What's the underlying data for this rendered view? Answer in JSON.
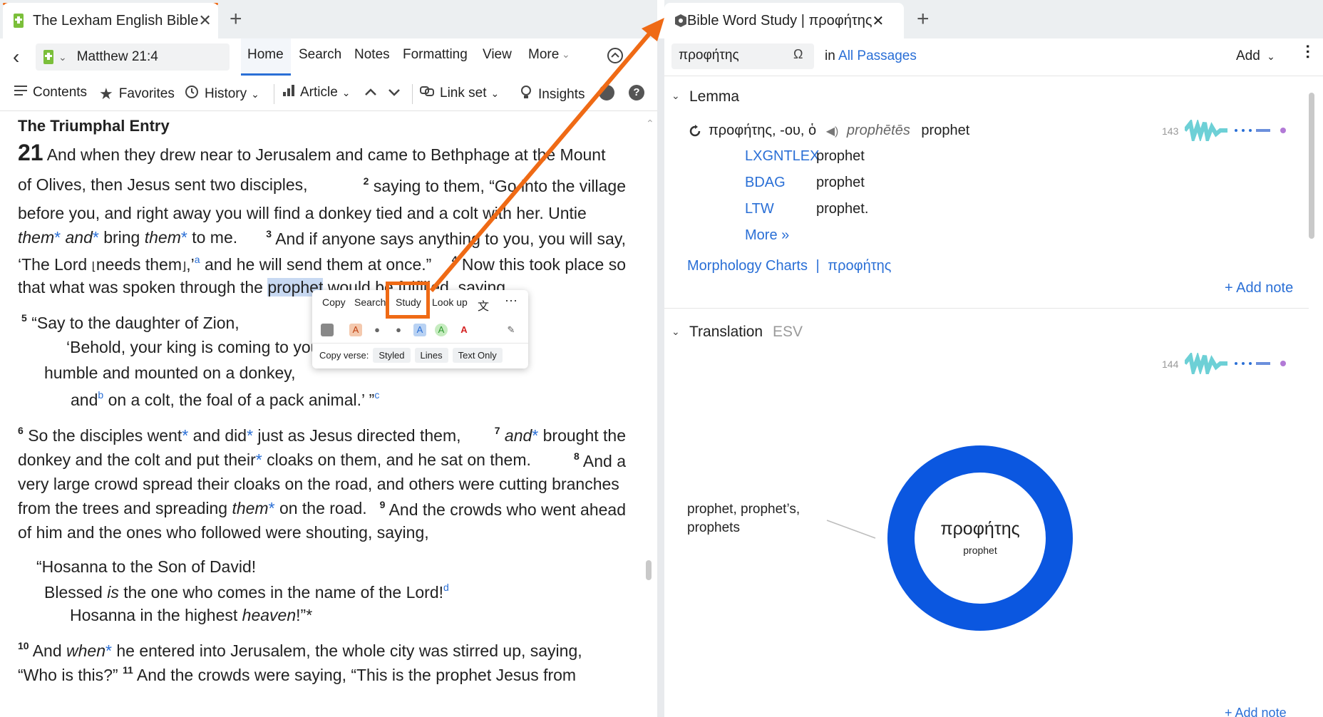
{
  "left": {
    "tab_title": "The Lexham English Bible",
    "reference": "Matthew 21:4",
    "nav": [
      "Home",
      "Search",
      "Notes",
      "Formatting",
      "View",
      "More"
    ],
    "toolbar": {
      "contents": "Contents",
      "favorites": "Favorites",
      "history": "History",
      "article": "Article",
      "link_set": "Link set",
      "insights": "Insights"
    },
    "passage": {
      "heading": "The Triumphal Entry",
      "chapter": "21",
      "l1": "And when they drew near to Jerusalem and came to Bethphage at the Mount",
      "l2a": "of Olives, then Jesus sent two disciples,",
      "v2": "2",
      "l2b": "saying to them, “Go into the village",
      "l3": "before you, and right away you will find a donkey tied and a colt with her. Untie",
      "l4a": "them",
      "l4b": "and",
      "l4c": "bring",
      "l4d": "them",
      "l4e": "to me.",
      "v3": "3",
      "l4f": "And if anyone says anything to you, you will say,",
      "l5a": "‘The Lord",
      "l5b": "needs them",
      "l5c": ",’",
      "fn_a": "a",
      "l5d": "and he will send them at once.”",
      "v4": "4",
      "l5e": "Now this took place so",
      "l6a": "that what was spoken through the",
      "l6hl": "prophet",
      "l6b": "would be fulfilled, saying,",
      "v5": "5",
      "q1": "“Say to the daughter of Zion,",
      "q2": "‘Behold, your king is coming to you,",
      "q3": "humble and mounted on a donkey,",
      "q4a": "and",
      "fn_b": "b",
      "q4b": "on a colt, the foal of a pack animal.’ ”",
      "fn_c": "c",
      "v6": "6",
      "p1a": "So the disciples went",
      "p1b": "and did",
      "p1c": "just as Jesus directed them,",
      "v7": "7",
      "p1d": "and",
      "p1e": "brought the",
      "p2a": "donkey and the colt and put their",
      "p2b": "cloaks on them, and he sat on them.",
      "v8": "8",
      "p2c": "And a",
      "p3": "very large crowd spread their cloaks on the road, and others were cutting branches",
      "p4a": "from the trees and spreading",
      "p4b": "them",
      "p4c": "on the road.",
      "v9": "9",
      "p4d": "And the crowds who went ahead",
      "p5": "of him and the ones who followed were shouting, saying,",
      "h1": "“Hosanna to the Son of David!",
      "h2a": "Blessed",
      "h2b": "is",
      "h2c": "the one who comes in the name of the Lord!",
      "fn_d": "d",
      "h3a": "Hosanna in the highest",
      "h3b": "heaven",
      "h3c": "!”",
      "v10": "10",
      "e1a": "And",
      "e1b": "when",
      "e1c": "he entered into Jerusalem, the whole city was stirred up, saying,",
      "e2a": "“Who is this?”",
      "v11": "11",
      "e2b": "And the crowds were saying, “This is the prophet Jesus from",
      "star": "*"
    },
    "popup": {
      "items": [
        "Copy",
        "Search",
        "Study",
        "Look up"
      ],
      "copy_verse_label": "Copy verse:",
      "copy_options": [
        "Styled",
        "Lines",
        "Text Only"
      ]
    }
  },
  "right": {
    "tab_title": "Bible Word Study | προφήτης",
    "search_value": "προφήτης",
    "in_label": "in",
    "scope": "All Passages",
    "add_label": "Add",
    "lemma_section": "Lemma",
    "lemma_entry": "προφήτης, -ου, ὁ",
    "translit": "prophētēs",
    "gloss": "prophet",
    "count_lemma": "143",
    "dictionaries": [
      {
        "name": "LXGNTLEX",
        "def": "prophet"
      },
      {
        "name": "BDAG",
        "def": "prophet"
      },
      {
        "name": "LTW",
        "def": "prophet."
      }
    ],
    "more": "More »",
    "morph_charts": "Morphology Charts",
    "morph_sep": "|",
    "morph_word": "προφήτης",
    "add_note": "+ Add note",
    "translation_section": "Translation",
    "translation_version": "ESV",
    "count_translation": "144",
    "chart_center_word": "προφήτης",
    "chart_center_sub": "prophet",
    "chart_label_line1": "prophet, prophet’s,",
    "chart_label_line2": "prophets",
    "add_note_bottom": "+ Add note"
  },
  "colors": {
    "accent": "#2a6fd6",
    "annotation": "#ef6a15",
    "donut": "#0b57e0",
    "highlight": "#c8d9f2"
  },
  "chart_data": {
    "type": "pie",
    "categories": [
      "prophet, prophet’s, prophets"
    ],
    "values": [
      100
    ],
    "title": "",
    "center_label": "προφήτης"
  }
}
